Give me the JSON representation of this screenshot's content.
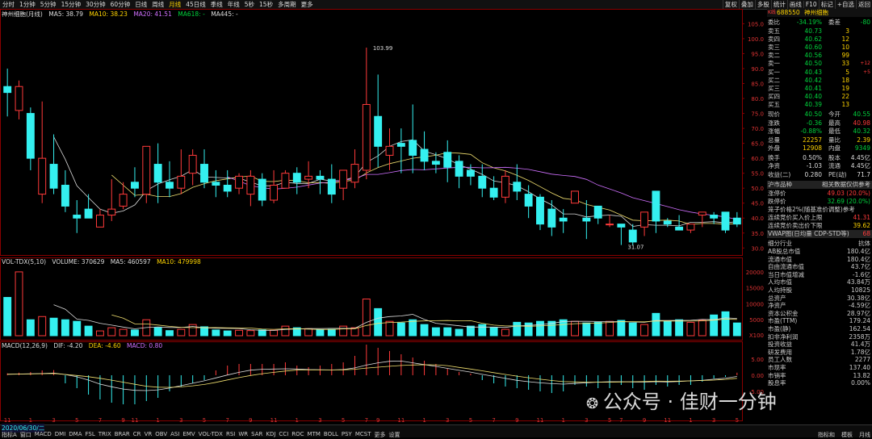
{
  "toolbar": {
    "left": [
      "分时",
      "1分钟",
      "5分钟",
      "15分钟",
      "30分钟",
      "60分钟",
      "日线",
      "周线",
      "月线",
      "45日线",
      "季线",
      "年线",
      "5秒",
      "15秒",
      "多周期",
      "更多"
    ],
    "right": [
      "复权",
      "叠加",
      "多股",
      "统计",
      "画线",
      "F10",
      "标记",
      "+自选",
      "返回"
    ]
  },
  "chart": {
    "title": "神州细胞(月线)",
    "ma": [
      "MA5: 38.79",
      "MA10: 38.23",
      "MA20: 41.51",
      "MA618: -",
      "MA445: -"
    ],
    "ylabels": [
      "105.0",
      "100.0",
      "95.0",
      "90.0",
      "85.0",
      "80.0",
      "75.0",
      "70.0",
      "65.0",
      "60.0",
      "55.0",
      "50.0",
      "45.0",
      "40.0",
      "35.0",
      "30.0"
    ],
    "high_label": "103.99",
    "low_label": "31.07",
    "vol_header": [
      "VOL-TDX(5,10)",
      "VOLUME: 370629",
      "MA5: 460597",
      "MA10: 479998"
    ],
    "vol_ylabels": [
      "20000",
      "15000",
      "10000",
      "5000",
      "X100"
    ],
    "macd_header": [
      "MACD(12,26,9)",
      "DIF: -4.20",
      "DEA: -4.60",
      "MACD: 0.80"
    ],
    "macd_ylabels": [
      "5.00",
      "0.00",
      "-5.00"
    ],
    "xlabels": [
      "11",
      "1",
      "3",
      "5",
      "7",
      "9",
      "11",
      "1",
      "3",
      "5",
      "7",
      "9",
      "11",
      "1",
      "3",
      "5",
      "7",
      "9",
      "11",
      "1",
      "3",
      "5",
      "7",
      "9",
      "11",
      "1",
      "3",
      "5",
      "7",
      "9",
      "11",
      "1",
      "3",
      "5"
    ],
    "date": "2020/06/30/二",
    "watermark": "公众号 · 佳财一分钟"
  },
  "chart_data": {
    "type": "candlestick",
    "candles": [
      [
        84,
        82,
        90,
        74
      ],
      [
        76,
        84,
        86,
        73
      ],
      [
        75,
        60,
        77,
        56
      ],
      [
        48,
        60,
        79,
        45
      ],
      [
        58,
        50,
        68,
        48
      ],
      [
        51,
        44,
        56,
        42
      ],
      [
        41,
        40,
        46,
        35
      ],
      [
        43,
        40,
        48,
        40
      ],
      [
        37,
        41,
        43,
        37
      ],
      [
        41,
        43,
        53,
        39
      ],
      [
        44,
        48,
        52,
        43
      ],
      [
        52,
        50,
        57,
        47
      ],
      [
        48,
        64,
        64,
        45
      ],
      [
        58,
        52,
        65,
        45
      ],
      [
        52,
        50,
        59,
        47
      ],
      [
        50,
        54,
        63,
        48
      ],
      [
        55,
        61,
        63,
        51
      ],
      [
        58,
        52,
        63,
        50
      ],
      [
        52,
        51,
        56,
        47
      ],
      [
        51,
        49,
        56,
        47
      ],
      [
        50,
        54,
        55,
        48
      ],
      [
        48,
        54,
        56,
        44
      ],
      [
        53,
        46,
        55,
        44
      ],
      [
        46,
        51,
        56,
        45
      ],
      [
        50,
        55,
        56,
        50
      ],
      [
        55,
        52,
        57,
        48
      ],
      [
        53,
        54,
        59,
        50
      ],
      [
        54,
        53,
        56,
        48
      ],
      [
        53,
        48,
        58,
        45
      ],
      [
        50,
        56,
        56,
        46
      ],
      [
        52,
        58,
        63,
        50
      ],
      [
        56,
        78,
        97,
        53
      ],
      [
        74,
        64,
        88,
        57
      ],
      [
        61,
        64,
        70,
        56
      ],
      [
        65,
        64,
        70,
        55
      ],
      [
        66,
        61,
        78,
        55
      ],
      [
        63,
        59,
        69,
        56
      ],
      [
        59,
        58,
        62,
        55
      ],
      [
        62,
        57,
        66,
        52
      ],
      [
        59,
        54,
        61,
        50
      ],
      [
        56,
        54,
        58,
        51
      ],
      [
        54,
        50,
        58,
        47
      ],
      [
        50,
        47,
        54,
        46
      ],
      [
        47,
        54,
        56,
        45
      ],
      [
        52,
        49,
        58,
        46
      ],
      [
        48,
        44,
        51,
        40
      ],
      [
        47,
        38,
        48,
        36
      ],
      [
        43,
        37,
        46,
        34
      ],
      [
        40,
        39,
        43,
        35
      ],
      [
        45,
        49,
        49,
        45
      ],
      [
        40,
        39,
        46,
        33
      ],
      [
        44,
        40,
        43,
        38
      ],
      [
        38,
        38,
        41,
        37
      ],
      [
        38,
        37,
        37,
        31
      ],
      [
        36,
        32,
        38,
        31
      ],
      [
        37,
        42,
        42,
        34
      ],
      [
        49,
        39,
        49,
        35
      ],
      [
        39,
        38,
        40,
        37
      ],
      [
        37,
        36,
        41,
        36
      ],
      [
        36,
        38,
        38,
        35
      ],
      [
        41,
        42,
        42,
        37
      ],
      [
        41,
        40,
        42,
        38
      ],
      [
        42,
        36,
        42,
        35
      ],
      [
        40,
        38,
        42,
        37
      ]
    ],
    "volume": [
      12000,
      20000,
      5000,
      6000,
      5500,
      5000,
      4500,
      3000,
      1500,
      2500,
      2000,
      1800,
      5000,
      2500,
      1600,
      2000,
      3500,
      2800,
      1800,
      1500,
      1700,
      1600,
      1800,
      1700,
      3000,
      2500,
      2200,
      1800,
      2000,
      3000,
      2500,
      11500,
      8500,
      4500,
      4000,
      5000,
      3500,
      2500,
      2500,
      2000,
      3000,
      3500,
      2500,
      2000,
      4200,
      4000,
      4500,
      4500,
      5000,
      4500,
      4000,
      4200,
      4500,
      4800,
      4000,
      3500,
      7000,
      4500,
      5000,
      4200,
      4800,
      6500,
      7500,
      4000
    ],
    "macd": [
      0.6,
      0.8,
      1.0,
      1.5,
      1.6,
      -2.5,
      -4.0,
      -6.0,
      -7.5,
      -8.5,
      -9.0,
      -9.0,
      -8.0,
      -7.0,
      -5.0,
      -3.5,
      -2.5,
      -1.5,
      1.5,
      3.0,
      3.5,
      3.5,
      3.5,
      3.5,
      4.0,
      3.0,
      2.5,
      3.0,
      3.5,
      4.0,
      6.0,
      9.5,
      8.5,
      7.5,
      6.5,
      5.5,
      4.5,
      3.5,
      2.0,
      1.0,
      0.5,
      -1.5,
      -2.5,
      -3.5,
      -4.0,
      -4.5,
      -5.0,
      -5.5,
      -5.0,
      -3.0,
      -3.5,
      -4.0,
      -4.0,
      -3.0,
      -4.0,
      -4.5,
      -3.0,
      -3.5,
      -3.0,
      -3.0,
      -2.0,
      -1.0,
      -0.5,
      0.8
    ],
    "ylim": [
      29,
      107
    ],
    "vol_ylim": [
      0,
      22000
    ],
    "macd_ylim": [
      -12,
      8
    ]
  },
  "quote": {
    "title_code": "688550",
    "title_name": "神州细胞",
    "title_tag": "K线",
    "weibi_label": "委比",
    "weibi_val": "-34.19%",
    "weicha_label": "委差",
    "weicha_val": "-80",
    "asks": [
      [
        "卖五",
        "40.73",
        "3",
        ""
      ],
      [
        "卖四",
        "40.62",
        "12",
        ""
      ],
      [
        "卖三",
        "40.60",
        "10",
        ""
      ],
      [
        "卖二",
        "40.56",
        "99",
        ""
      ],
      [
        "卖一",
        "40.50",
        "33",
        "+12"
      ]
    ],
    "bids": [
      [
        "买一",
        "40.43",
        "5",
        "+5"
      ],
      [
        "买二",
        "40.42",
        "18",
        ""
      ],
      [
        "买三",
        "40.41",
        "19",
        ""
      ],
      [
        "买四",
        "40.40",
        "22",
        ""
      ],
      [
        "买五",
        "40.39",
        "13",
        ""
      ]
    ],
    "stats": [
      [
        "现价",
        "40.50",
        "今开",
        "40.55"
      ],
      [
        "涨跌",
        "-0.36",
        "最高",
        "40.98"
      ],
      [
        "涨幅",
        "-0.88%",
        "最低",
        "40.32"
      ],
      [
        "总量",
        "22257",
        "量比",
        "2.39"
      ],
      [
        "外盘",
        "12908",
        "内盘",
        "9349"
      ]
    ],
    "stats2": [
      [
        "换手",
        "0.50%",
        "股本",
        "4.45亿"
      ],
      [
        "净资",
        "-1.03",
        "流通",
        "4.45亿"
      ],
      [
        "收益(二)",
        "0.280",
        "PE(动)",
        "71.7"
      ]
    ],
    "sect_hu": "沪市品种",
    "sect_hu_right": "相关数据仅供参考",
    "limit": [
      [
        "涨停价",
        "49.03 (20.0%)"
      ],
      [
        "跌停价",
        "32.69 (20.0%)"
      ]
    ],
    "bid_note": "笼子价格2%(随基准价调整)参考",
    "range": [
      [
        "连续竞价买入价上限",
        "41.31"
      ],
      [
        "连续竞价卖出价下限",
        "39.62"
      ]
    ],
    "vwap": "VWAP图(日均量 CDP-STD等)",
    "vwap_val": "68",
    "industry_label": "细分行业",
    "industry_val": "抗体",
    "fund": [
      [
        "AB股总市值",
        "180.4亿"
      ],
      [
        "流通市值",
        "180.4亿"
      ],
      [
        "自由流通市值",
        "43.7亿"
      ],
      [
        "当日市值增减",
        "-1.6亿"
      ],
      [
        "人均市值",
        "43.84万"
      ],
      [
        "人均持股",
        "10825"
      ],
      [
        "总资产",
        "30.38亿"
      ],
      [
        "净资产",
        "-4.59亿"
      ],
      [
        "资本公积金",
        "28.97亿"
      ],
      [
        "市盈(TTM)",
        "179.24"
      ],
      [
        "市盈(静)",
        "162.54"
      ],
      [
        "扣非净利润",
        "2358万"
      ],
      [
        "投资收益",
        "41.4万"
      ],
      [
        "研发费用",
        "1.78亿"
      ],
      [
        "员工人数",
        "2277"
      ],
      [
        "市现率",
        "137.40"
      ],
      [
        "市销率",
        "13.82"
      ],
      [
        "股息率",
        "0.00%"
      ]
    ]
  },
  "bottom": {
    "tabs": [
      "指标A",
      "窗口",
      "MACD",
      "DMI",
      "DMA",
      "FSL",
      "TRIX",
      "BRAR",
      "CR",
      "VR",
      "OBV",
      "ASI",
      "EMV",
      "VOL-TDX",
      "RSI",
      "WR",
      "SAR",
      "KDJ",
      "CCI",
      "ROC",
      "MTM",
      "BOLL",
      "PSY",
      "MCST",
      "更多",
      "设置"
    ],
    "right": [
      "指标和",
      "模板",
      "月线"
    ]
  },
  "colors": {
    "up": "#ff3a3a",
    "down": "#34f0f0",
    "ma5": "#dcdcdc",
    "ma10": "#f2e070",
    "ma20": "#d070ff"
  }
}
